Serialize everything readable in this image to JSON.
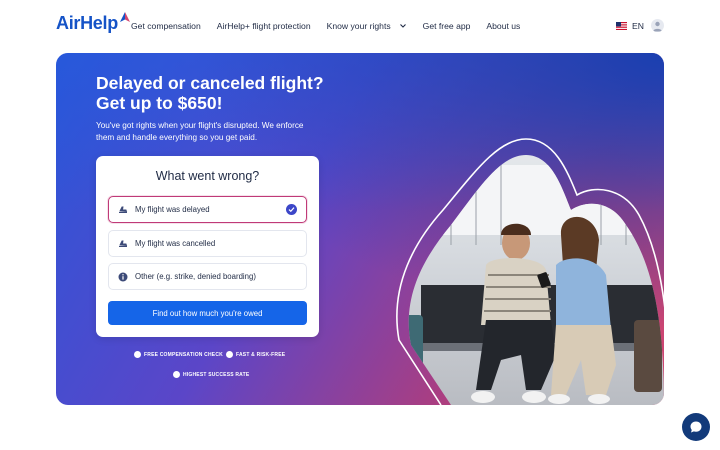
{
  "brand": {
    "name": "AirHelp",
    "color": "#1553c7"
  },
  "nav": {
    "items": [
      {
        "label": "Get compensation"
      },
      {
        "label": "AirHelp+ flight protection"
      },
      {
        "label": "Know your rights"
      },
      {
        "label": "Get free app"
      },
      {
        "label": "About us"
      }
    ],
    "language": "EN"
  },
  "hero": {
    "title_line1": "Delayed or canceled flight?",
    "title_line2": "Get up to $650!",
    "subtitle_line1": "You've got rights when your flight's disrupted. We enforce",
    "subtitle_line2": "them and handle everything so you get paid."
  },
  "card": {
    "title": "What went wrong?",
    "options": [
      {
        "label": "My flight was delayed",
        "icon": "plane-icon",
        "selected": true
      },
      {
        "label": "My flight was cancelled",
        "icon": "plane-icon",
        "selected": false
      },
      {
        "label": "Other (e.g. strike, denied boarding)",
        "icon": "info-icon",
        "selected": false
      }
    ],
    "cta": "Find out how much you're owed"
  },
  "badges": [
    {
      "label": "FREE COMPENSATION CHECK",
      "icon": "euro-icon"
    },
    {
      "label": "FAST & RISK-FREE",
      "icon": "lightning-icon"
    },
    {
      "label": "HIGHEST SUCCESS RATE",
      "icon": "shield-icon"
    }
  ],
  "colors": {
    "accent": "#1565e8",
    "selected_border": "#c03a78",
    "chat": "#123a7a"
  }
}
